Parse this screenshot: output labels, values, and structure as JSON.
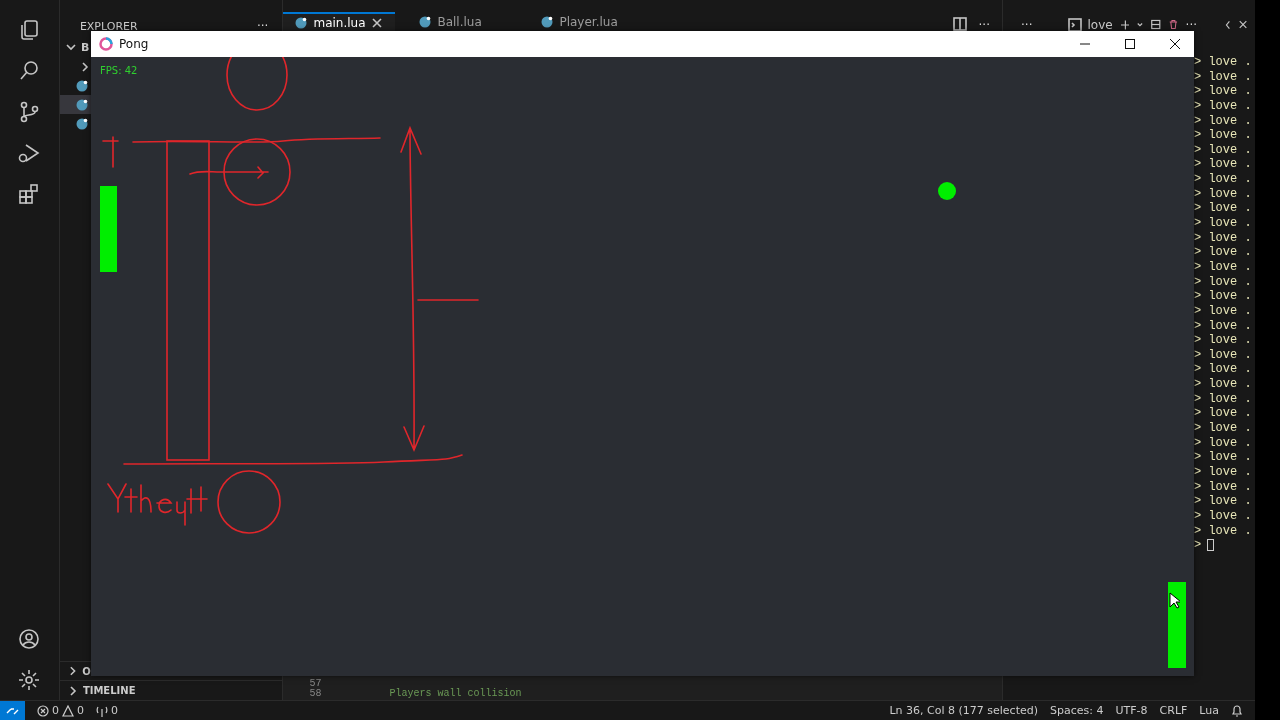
{
  "sidebar": {
    "title": "EXPLORER",
    "more": "···",
    "folder": "B",
    "file_rows": [
      {
        "selected": false
      },
      {
        "selected": true
      },
      {
        "selected": false
      }
    ],
    "sections": [
      {
        "label": "O"
      },
      {
        "label": "TIMELINE"
      }
    ]
  },
  "tabs": [
    {
      "label": "main.lua",
      "selected": true
    },
    {
      "label": "Ball.lua",
      "selected": false
    },
    {
      "label": "Player.lua",
      "selected": false
    }
  ],
  "editor_actions": {
    "more": "···"
  },
  "editor": {
    "lines": [
      {
        "number": "57"
      },
      {
        "number": "58",
        "code": "Players wall collision"
      }
    ]
  },
  "terminal_header": {
    "more_left": "···",
    "shell": "love",
    "more": "···"
  },
  "terminal": {
    "lines": [
      "> love .",
      "> love .",
      "> love .",
      "> love .",
      "> love .",
      "> love .",
      "> love .",
      "> love .",
      "> love .",
      "> love .",
      "> love .",
      "> love .",
      "> love .",
      "> love .",
      "> love .",
      "> love .",
      "> love .",
      "> love .",
      "> love .",
      "> love .",
      "> love .",
      "> love .",
      "> love .",
      "> love .",
      "> love .",
      "> love .",
      "> love .",
      "> love .",
      "> love .",
      "> love .",
      "> love .",
      "> love .",
      "> love ."
    ],
    "prompt": ">"
  },
  "game_window": {
    "title": "Pong",
    "fps": "FPS: 42"
  },
  "status_bar": {
    "errors": "0",
    "warnings": "0",
    "ports": "0",
    "position": "Ln 36, Col 8 (177 selected)",
    "spaces": "Spaces: 4",
    "encoding": "UTF-8",
    "eol": "CRLF",
    "language": "Lua"
  }
}
